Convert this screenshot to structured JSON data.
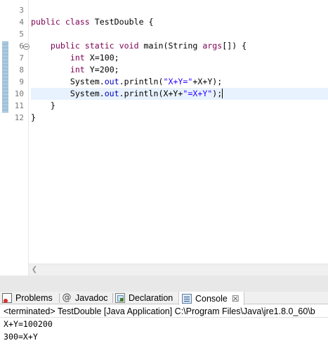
{
  "editor": {
    "line_numbers": [
      "3",
      "4",
      "5",
      "6",
      "7",
      "8",
      "9",
      "10",
      "11",
      "12"
    ],
    "lines": [
      [],
      [
        {
          "t": "kw",
          "v": "public class"
        },
        {
          "t": "pln",
          "v": " TestDouble {"
        }
      ],
      [],
      [
        {
          "t": "pln",
          "v": "    "
        },
        {
          "t": "kw",
          "v": "public static void"
        },
        {
          "t": "pln",
          "v": " main(String "
        },
        {
          "t": "kw2",
          "v": "args"
        },
        {
          "t": "pln",
          "v": "[]) {"
        }
      ],
      [
        {
          "t": "pln",
          "v": "        "
        },
        {
          "t": "kw",
          "v": "int"
        },
        {
          "t": "pln",
          "v": " X=100;"
        }
      ],
      [
        {
          "t": "pln",
          "v": "        "
        },
        {
          "t": "kw",
          "v": "int"
        },
        {
          "t": "pln",
          "v": " Y=200;"
        }
      ],
      [
        {
          "t": "pln",
          "v": "        System."
        },
        {
          "t": "field",
          "v": "out"
        },
        {
          "t": "pln",
          "v": ".println("
        },
        {
          "t": "str",
          "v": "\"X+Y=\""
        },
        {
          "t": "pln",
          "v": "+X+Y);"
        }
      ],
      [
        {
          "t": "pln",
          "v": "        System."
        },
        {
          "t": "field",
          "v": "out"
        },
        {
          "t": "pln",
          "v": ".println(X+Y+"
        },
        {
          "t": "str",
          "v": "\"=X+Y\""
        },
        {
          "t": "pln",
          "v": ");"
        }
      ],
      [
        {
          "t": "pln",
          "v": "    }"
        }
      ],
      [
        {
          "t": "pln",
          "v": "}"
        }
      ]
    ],
    "current_line": "10"
  },
  "tabs": [
    {
      "label": "Problems",
      "icon": "problems-icon",
      "active": false
    },
    {
      "label": "Javadoc",
      "icon": "javadoc-icon",
      "active": false
    },
    {
      "label": "Declaration",
      "icon": "declaration-icon",
      "active": false
    },
    {
      "label": "Console",
      "icon": "console-icon",
      "active": true,
      "close": "☒"
    }
  ],
  "console": {
    "status": "<terminated> TestDouble [Java Application] C:\\Program Files\\Java\\jre1.8.0_60\\b",
    "output": [
      "X+Y=100200",
      "300=X+Y"
    ]
  },
  "colors": {
    "keyword": "#7f0055",
    "string": "#2a00ff",
    "field": "#0000c0",
    "current_line": "#e8f2fe"
  }
}
